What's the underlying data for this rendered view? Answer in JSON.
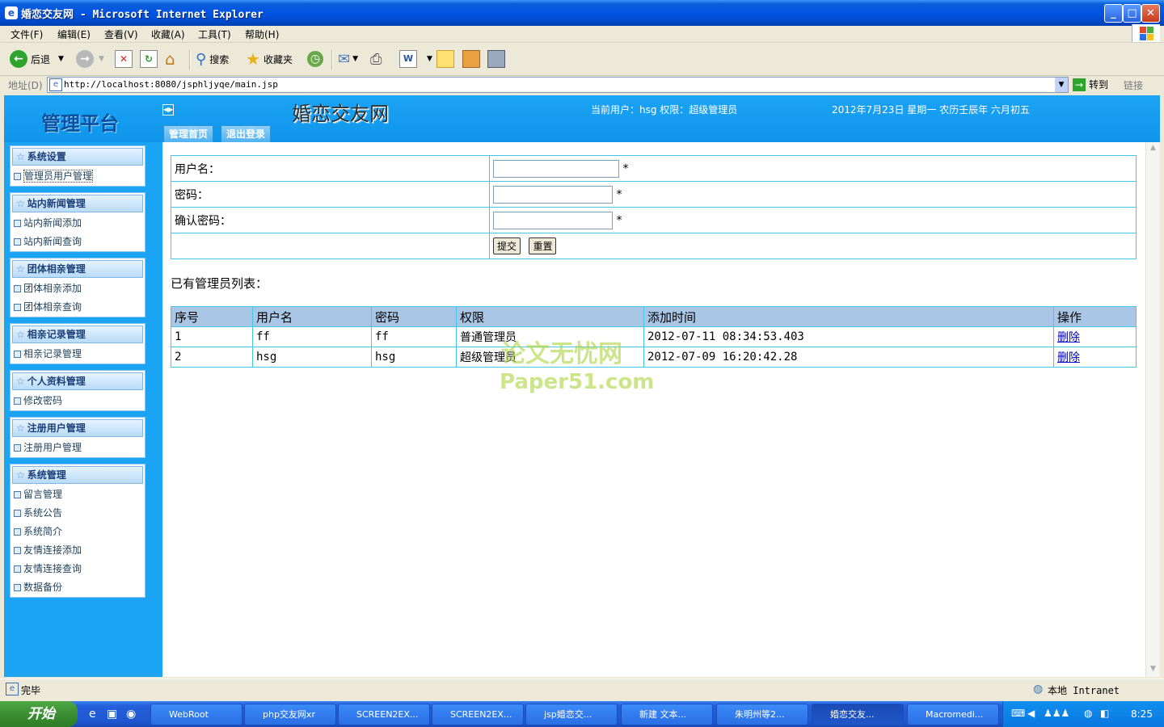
{
  "window": {
    "title": "婚恋交友网 - Microsoft Internet Explorer"
  },
  "menu": [
    "文件(F)",
    "编辑(E)",
    "查看(V)",
    "收藏(A)",
    "工具(T)",
    "帮助(H)"
  ],
  "toolbar": {
    "back": "后退",
    "search": "搜索",
    "favorites": "收藏夹"
  },
  "address": {
    "label": "地址(D)",
    "url": "http://localhost:8080/jsphljyqe/main.jsp",
    "go": "转到",
    "links": "链接"
  },
  "header": {
    "platform_title": "管理平台",
    "site_title": "婚恋交友网",
    "user_info": "当前用户：hsg 权限：超级管理员",
    "date_info": "2012年7月23日 星期一 农历壬辰年 六月初五",
    "tabs": [
      "管理首页",
      "退出登录"
    ]
  },
  "sidebar": [
    {
      "title": "系统设置",
      "items": [
        "管理员用户管理"
      ]
    },
    {
      "title": "站内新闻管理",
      "items": [
        "站内新闻添加",
        "站内新闻查询"
      ]
    },
    {
      "title": "团体相亲管理",
      "items": [
        "团体相亲添加",
        "团体相亲查询"
      ]
    },
    {
      "title": "相亲记录管理",
      "items": [
        "相亲记录管理"
      ]
    },
    {
      "title": "个人资料管理",
      "items": [
        "修改密码"
      ]
    },
    {
      "title": "注册用户管理",
      "items": [
        "注册用户管理"
      ]
    },
    {
      "title": "系统管理",
      "items": [
        "留言管理",
        "系统公告",
        "系统简介",
        "友情连接添加",
        "友情连接查询",
        "数据备份"
      ]
    }
  ],
  "form": {
    "username_label": "用户名：",
    "password_label": "密码：",
    "confirm_label": "确认密码：",
    "required": "*",
    "submit": "提交",
    "reset": "重置"
  },
  "list": {
    "title": "已有管理员列表：",
    "headers": [
      "序号",
      "用户名",
      "密码",
      "权限",
      "添加时间",
      "操作"
    ],
    "rows": [
      [
        "1",
        "ff",
        "ff",
        "普通管理员",
        "2012-07-11 08:34:53.403",
        "删除"
      ],
      [
        "2",
        "hsg",
        "hsg",
        "超级管理员",
        "2012-07-09 16:20:42.28",
        "删除"
      ]
    ]
  },
  "watermark": {
    "line1": "论文无忧网",
    "line2": "Paper51.com"
  },
  "status": {
    "text": "完毕",
    "zone": "本地 Intranet"
  },
  "taskbar": {
    "start": "开始",
    "tasks": [
      "WebRoot",
      "php交友网xr",
      "SCREEN2EX...",
      "SCREEN2EX...",
      "jsp婚恋交...",
      "新建 文本...",
      "朱明州等2...",
      "婚恋交友...",
      "Macromedi..."
    ],
    "clock": "8:25"
  }
}
